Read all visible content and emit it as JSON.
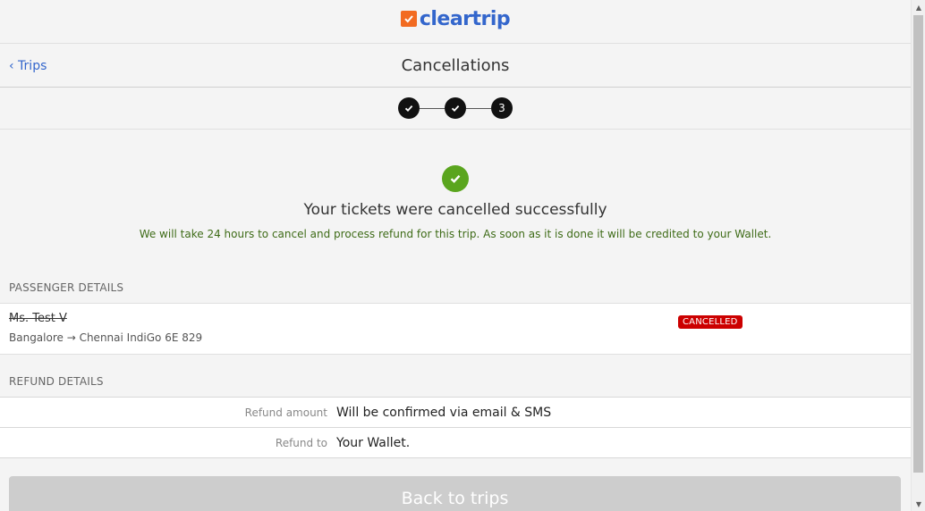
{
  "header": {
    "logo_text": "cleartrip",
    "brand_color": "#f26b21",
    "logo_text_color": "#3366cc"
  },
  "nav": {
    "back_label": "‹ Trips",
    "title": "Cancellations"
  },
  "stepper": {
    "steps": [
      {
        "state": "done",
        "icon": "check-icon"
      },
      {
        "state": "done",
        "icon": "check-icon"
      },
      {
        "state": "current",
        "label": "3"
      }
    ]
  },
  "success": {
    "icon": "check-circle-icon",
    "icon_color": "#5aa51e",
    "title": "Your tickets were cancelled successfully",
    "message": "We will take 24 hours to cancel and process refund for this trip. As soon as it is done it will be credited to your Wallet."
  },
  "passenger_section": {
    "heading": "PASSENGER DETAILS",
    "passenger": {
      "name": "Ms. Test V",
      "route": "Bangalore → Chennai IndiGo 6E 829",
      "status": "CANCELLED",
      "status_color": "#cc0000"
    }
  },
  "refund_section": {
    "heading": "REFUND DETAILS",
    "rows": [
      {
        "label": "Refund amount",
        "value": "Will be confirmed via email & SMS"
      },
      {
        "label": "Refund to",
        "value": "Your Wallet."
      }
    ]
  },
  "actions": {
    "back_button": "Back to trips"
  },
  "scrollbar": {
    "up_icon": "arrow-up-icon",
    "down_icon": "arrow-down-icon"
  }
}
